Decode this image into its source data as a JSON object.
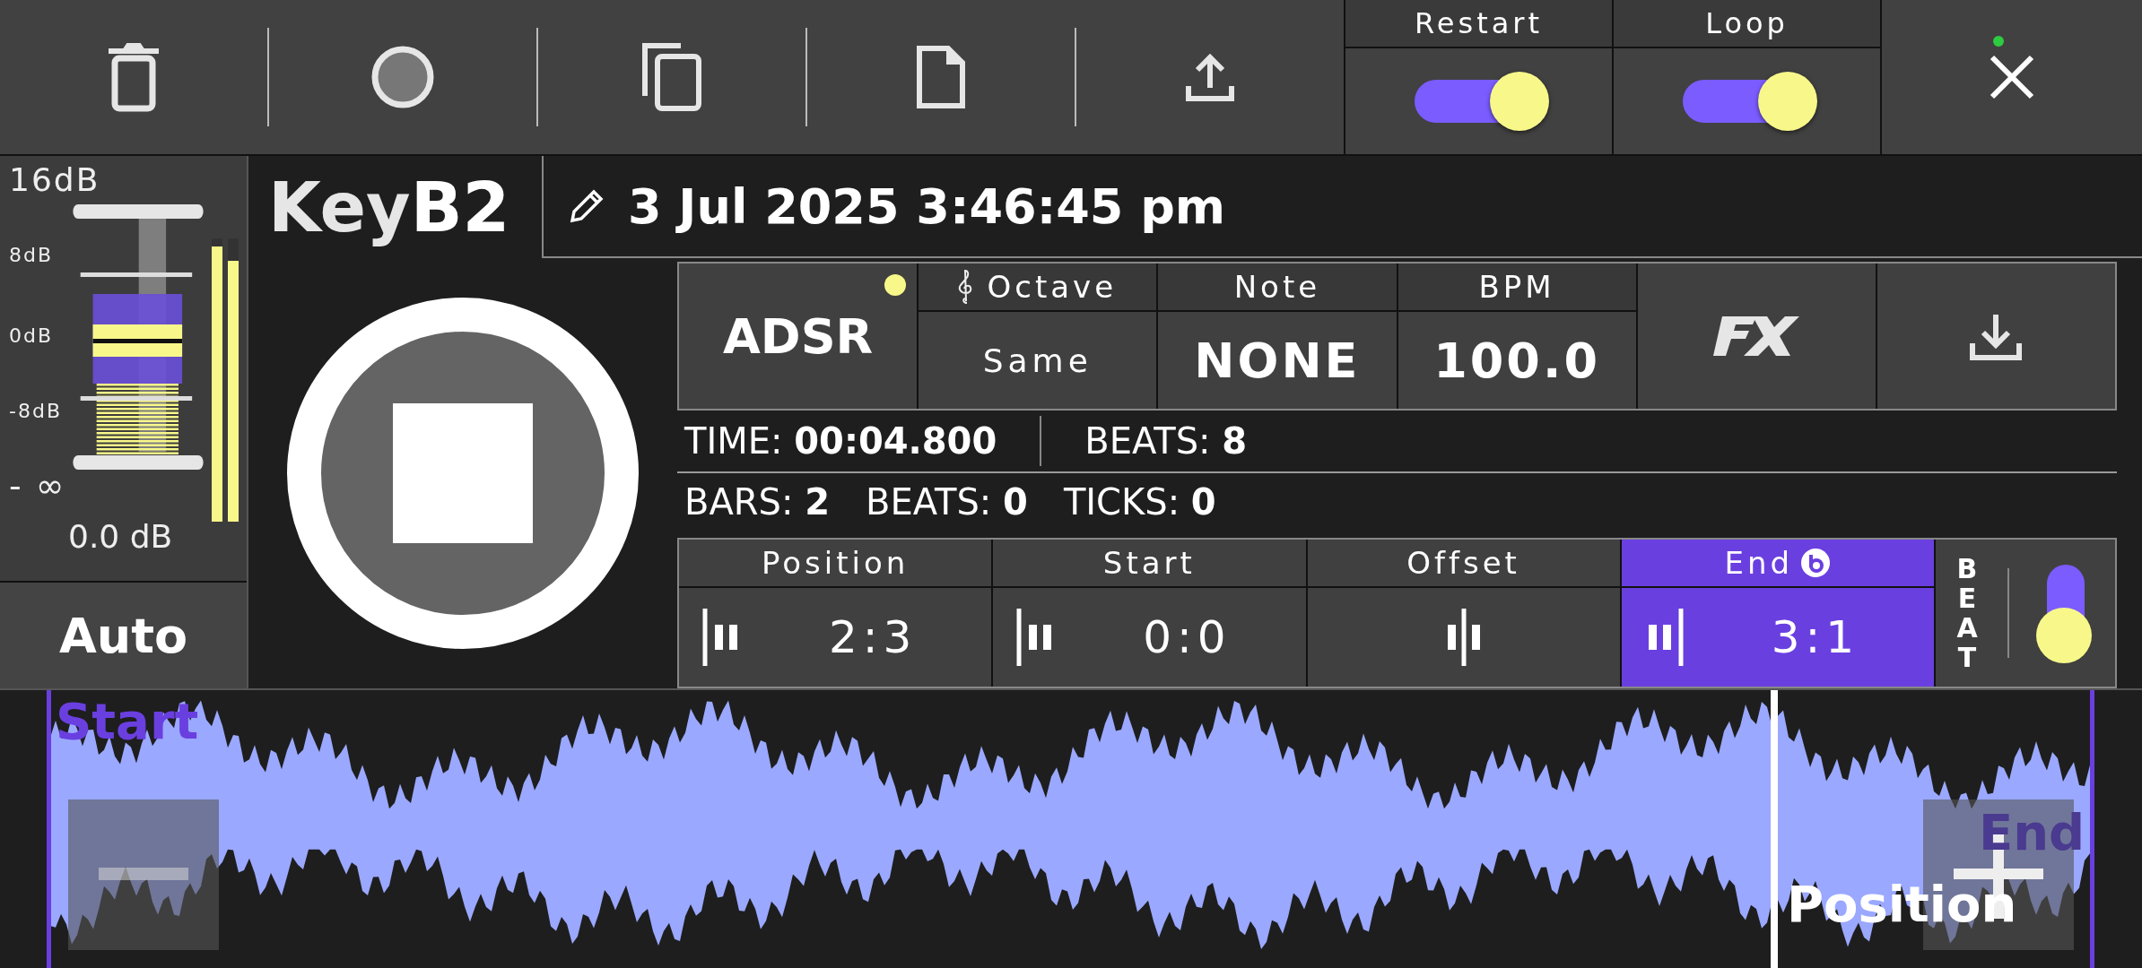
{
  "toggles": [
    {
      "label": "Restart",
      "on": true
    },
    {
      "label": "Loop",
      "on": true
    }
  ],
  "close": {
    "indicator": true
  },
  "meter": {
    "scale": [
      "16dB",
      "8dB",
      "0dB",
      "-8dB",
      "- ∞"
    ],
    "reading": "0.0 dB",
    "channels": [
      {
        "level": 0.97
      },
      {
        "level": 0.92
      }
    ]
  },
  "mode_button": "Auto",
  "title": {
    "prefix": "Key",
    "name": "B2"
  },
  "timestamp": "3 Jul 2025 3:46:45 pm",
  "params": {
    "adsr": {
      "label": "ADSR",
      "indicator": true
    },
    "fields": [
      {
        "label": "Octave",
        "value": "Same",
        "kind": "clef"
      },
      {
        "label": "Note",
        "value": "NONE",
        "kind": "plain"
      },
      {
        "label": "BPM",
        "value": "100.0",
        "kind": "plain"
      }
    ]
  },
  "time_info": {
    "time": "TIME: **00:04.800**",
    "beats": "BEATS: **8**"
  },
  "musical_time": [
    "BARS: **2**",
    "BEATS: **0**",
    "TICKS: **0**"
  ],
  "markers": [
    {
      "label": "Position",
      "value": "2:3",
      "kind": "left",
      "selected": false,
      "badge": false
    },
    {
      "label": "Start",
      "value": "0:0",
      "kind": "left",
      "selected": false,
      "badge": false
    },
    {
      "label": "Offset",
      "kind": "center",
      "selected": false,
      "badge": false
    },
    {
      "label": "End",
      "value": "3:1",
      "kind": "right",
      "selected": true,
      "badge": true
    }
  ],
  "beat_snap": {
    "label": "BEAT",
    "on": true
  },
  "waveform": {
    "start_label": "Start",
    "position_label": "Position",
    "end_label": "End"
  }
}
